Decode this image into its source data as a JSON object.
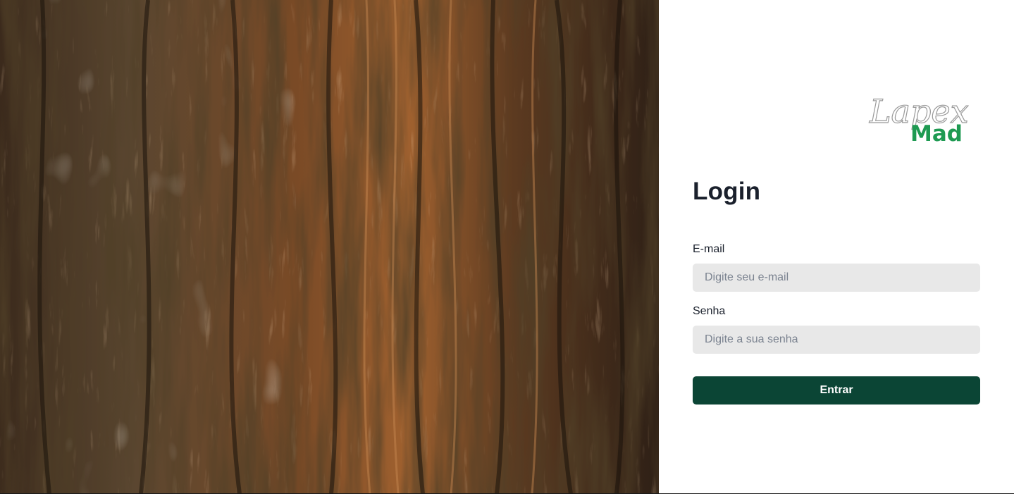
{
  "hero": {
    "image": "tree-bark-photo"
  },
  "brand": {
    "logo_line1": "Lapex",
    "logo_line2": "Mad"
  },
  "login": {
    "title": "Login",
    "email": {
      "label": "E-mail",
      "placeholder": "Digite seu e-mail",
      "value": ""
    },
    "password": {
      "label": "Senha",
      "placeholder": "Digite a sua senha",
      "value": ""
    },
    "submit_label": "Entrar"
  },
  "colors": {
    "button": "#0b4535",
    "logo_green": "#1e9a52",
    "input_bg": "#e8e8e8",
    "text": "#1a202c"
  }
}
